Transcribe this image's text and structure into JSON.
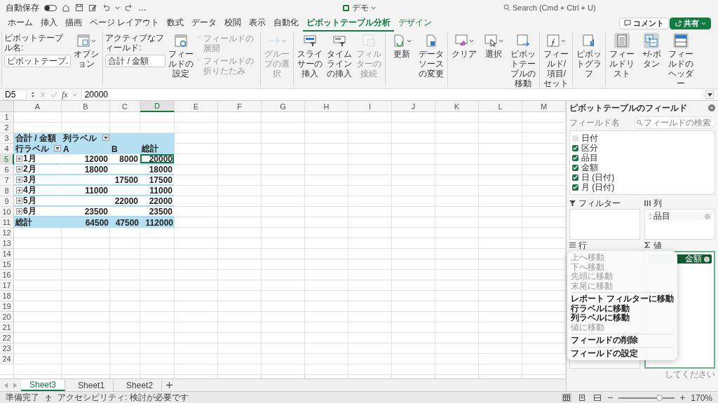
{
  "title_bar": {
    "autosave_label": "自動保存",
    "autosave_on": false,
    "more": "…",
    "document_title": "デモ",
    "search_placeholder": "Search (Cmd + Ctrl + U)"
  },
  "ribbon_tabs": [
    {
      "label": "ホーム",
      "selected": false,
      "kind": "normal"
    },
    {
      "label": "挿入",
      "selected": false,
      "kind": "normal"
    },
    {
      "label": "描画",
      "selected": false,
      "kind": "normal"
    },
    {
      "label": "ページ レイアウト",
      "selected": false,
      "kind": "normal"
    },
    {
      "label": "数式",
      "selected": false,
      "kind": "normal"
    },
    {
      "label": "データ",
      "selected": false,
      "kind": "normal"
    },
    {
      "label": "校閲",
      "selected": false,
      "kind": "normal"
    },
    {
      "label": "表示",
      "selected": false,
      "kind": "normal"
    },
    {
      "label": "自動化",
      "selected": false,
      "kind": "normal"
    },
    {
      "label": "ピボットテーブル分析",
      "selected": true,
      "kind": "contextual"
    },
    {
      "label": "デザイン",
      "selected": false,
      "kind": "contextual"
    }
  ],
  "header_buttons": [
    {
      "label": "コメント",
      "kind": "outline"
    },
    {
      "label": "共有",
      "kind": "primary"
    }
  ],
  "ribbon_groups": [
    [
      {
        "kind": "labeled-field",
        "caption": "ピボットテーブル名:",
        "value": "ピボットテーブ."
      },
      {
        "kind": "button",
        "label": "オプション",
        "disabled": false,
        "on": false,
        "dropdown": true
      }
    ],
    [
      {
        "kind": "labeled-field",
        "caption": "アクティブなフィールド:",
        "value": "合計 / 金額"
      },
      {
        "kind": "button",
        "label": "フィールドの設定",
        "disabled": false,
        "on": false,
        "dropdown": false
      },
      {
        "kind": "small-stack",
        "items": [
          {
            "label": "フィールドの展開",
            "disabled": true
          },
          {
            "label": "フィールドの折りたたみ",
            "disabled": true
          }
        ]
      }
    ],
    [
      {
        "kind": "button",
        "label": "グループの選択",
        "disabled": true,
        "on": false,
        "dropdown": true
      }
    ],
    [
      {
        "kind": "button",
        "label": "スライサーの挿入",
        "disabled": false,
        "on": false,
        "dropdown": false
      },
      {
        "kind": "button",
        "label": "タイムラインの挿入",
        "disabled": false,
        "on": false,
        "dropdown": false
      },
      {
        "kind": "button",
        "label": "フィルターの接続",
        "disabled": true,
        "on": false,
        "dropdown": false
      }
    ],
    [
      {
        "kind": "button",
        "label": "更新",
        "disabled": false,
        "on": false,
        "dropdown": true
      },
      {
        "kind": "button",
        "label": "データソースの変更",
        "disabled": false,
        "on": false,
        "dropdown": false
      }
    ],
    [
      {
        "kind": "button",
        "label": "クリア",
        "disabled": false,
        "on": false,
        "dropdown": true
      },
      {
        "kind": "button",
        "label": "選択",
        "disabled": false,
        "on": false,
        "dropdown": true
      },
      {
        "kind": "button",
        "label": "ピボットテーブルの移動",
        "disabled": false,
        "on": false,
        "dropdown": false
      }
    ],
    [
      {
        "kind": "button",
        "label": "フィールド/項目/セット",
        "disabled": false,
        "on": false,
        "dropdown": true
      }
    ],
    [
      {
        "kind": "button",
        "label": "ピボットグラフ",
        "disabled": false,
        "on": false,
        "dropdown": false
      }
    ],
    [
      {
        "kind": "button",
        "label": "フィールドリスト",
        "disabled": false,
        "on": true,
        "dropdown": false
      },
      {
        "kind": "button",
        "label": "+/-ボタン",
        "disabled": false,
        "on": true,
        "dropdown": false
      },
      {
        "kind": "button",
        "label": "フィールドのヘッダー",
        "disabled": false,
        "on": true,
        "dropdown": false
      }
    ]
  ],
  "formula_bar": {
    "name_box": "D5",
    "fx": "fx",
    "formula": "20000"
  },
  "sheet": {
    "columns": [
      {
        "label": "A",
        "selected": false
      },
      {
        "label": "B",
        "selected": false
      },
      {
        "label": "C",
        "selected": false
      },
      {
        "label": "D",
        "selected": true
      },
      {
        "label": "E",
        "selected": false
      },
      {
        "label": "F",
        "selected": false
      },
      {
        "label": "G",
        "selected": false
      },
      {
        "label": "H",
        "selected": false
      },
      {
        "label": "I",
        "selected": false
      },
      {
        "label": "J",
        "selected": false
      },
      {
        "label": "K",
        "selected": false
      },
      {
        "label": "L",
        "selected": false
      },
      {
        "label": "M",
        "selected": false
      }
    ],
    "rows": [
      {
        "label": "1",
        "selected": false
      },
      {
        "label": "2",
        "selected": false
      },
      {
        "label": "3",
        "selected": false
      },
      {
        "label": "4",
        "selected": false
      },
      {
        "label": "5",
        "selected": true
      },
      {
        "label": "6",
        "selected": false
      },
      {
        "label": "7",
        "selected": false
      },
      {
        "label": "8",
        "selected": false
      },
      {
        "label": "9",
        "selected": false
      },
      {
        "label": "10",
        "selected": false
      },
      {
        "label": "11",
        "selected": false
      },
      {
        "label": "12",
        "selected": false
      },
      {
        "label": "13",
        "selected": false
      },
      {
        "label": "14",
        "selected": false
      },
      {
        "label": "15",
        "selected": false
      },
      {
        "label": "16",
        "selected": false
      },
      {
        "label": "17",
        "selected": false
      },
      {
        "label": "18",
        "selected": false
      },
      {
        "label": "19",
        "selected": false
      },
      {
        "label": "20",
        "selected": false
      },
      {
        "label": "21",
        "selected": false
      },
      {
        "label": "22",
        "selected": false
      },
      {
        "label": "23",
        "selected": false
      },
      {
        "label": "24",
        "selected": false
      }
    ]
  },
  "pivot": {
    "value_label": "合計 / 金額",
    "column_label": "列ラベル",
    "row_label": "行ラベル",
    "column_headers": [
      "A",
      "B",
      "総計"
    ],
    "rows": [
      {
        "label": "1月",
        "value_a": "12000",
        "value_b": "8000",
        "grand_total": "20000"
      },
      {
        "label": "2月",
        "value_a": "18000",
        "grand_total": "18000"
      },
      {
        "label": "3月",
        "value_b": "17500",
        "grand_total": "17500"
      },
      {
        "label": "4月",
        "value_a": "11000",
        "grand_total": "11000"
      },
      {
        "label": "5月",
        "value_b": "22000",
        "grand_total": "22000"
      },
      {
        "label": "6月",
        "value_a": "23500",
        "grand_total": "23500"
      }
    ],
    "total": {
      "label": "総計",
      "value_a": "64500",
      "value_b": "47500",
      "grand_total": "112000"
    }
  },
  "sheet_tabs": [
    {
      "label": "Sheet3",
      "selected": true
    },
    {
      "label": "Sheet1",
      "selected": false
    },
    {
      "label": "Sheet2",
      "selected": false
    }
  ],
  "field_panel": {
    "title": "ピボットテーブルのフィールド",
    "field_name_label": "フィールド名",
    "search_placeholder": "フィールドの検索",
    "fields": [
      {
        "label": "日付",
        "checked": false
      },
      {
        "label": "区分",
        "checked": true
      },
      {
        "label": "品目",
        "checked": true
      },
      {
        "label": "金額",
        "checked": true
      },
      {
        "label": "日 (日付)",
        "checked": true
      },
      {
        "label": "月 (日付)",
        "checked": true
      }
    ],
    "areas": [
      {
        "label": "フィルター",
        "focused": false
      },
      {
        "label": "列",
        "focused": false,
        "items": [
          {
            "label": "品目",
            "selected": false
          }
        ]
      },
      {
        "label": "行",
        "focused": false
      },
      {
        "label": "値",
        "focused": true,
        "items": [
          {
            "label": "金額",
            "selected": true
          }
        ]
      }
    ],
    "hint": "してください"
  },
  "context_menu": [
    {
      "kind": "item",
      "label": "上へ移動",
      "disabled": true
    },
    {
      "kind": "item",
      "label": "下へ移動",
      "disabled": true
    },
    {
      "kind": "item",
      "label": "先頭に移動",
      "disabled": true
    },
    {
      "kind": "item",
      "label": "末尾に移動",
      "disabled": true
    },
    {
      "kind": "separator"
    },
    {
      "kind": "item",
      "label": "レポート フィルターに移動",
      "disabled": false
    },
    {
      "kind": "item",
      "label": "行ラベルに移動",
      "disabled": false
    },
    {
      "kind": "item",
      "label": "列ラベルに移動",
      "disabled": false
    },
    {
      "kind": "item",
      "label": "値に移動",
      "disabled": true
    },
    {
      "kind": "separator"
    },
    {
      "kind": "item",
      "label": "フィールドの削除",
      "disabled": false
    },
    {
      "kind": "separator"
    },
    {
      "kind": "item",
      "label": "フィールドの設定",
      "disabled": false
    }
  ],
  "status_bar": {
    "status": "準備完了",
    "accessibility": "アクセシビリティ: 検討が必要です",
    "views": [
      {
        "selected": true
      },
      {
        "selected": false
      },
      {
        "selected": false
      }
    ],
    "zoom_slider": {
      "level": 0.72
    },
    "zoom": "170%"
  }
}
